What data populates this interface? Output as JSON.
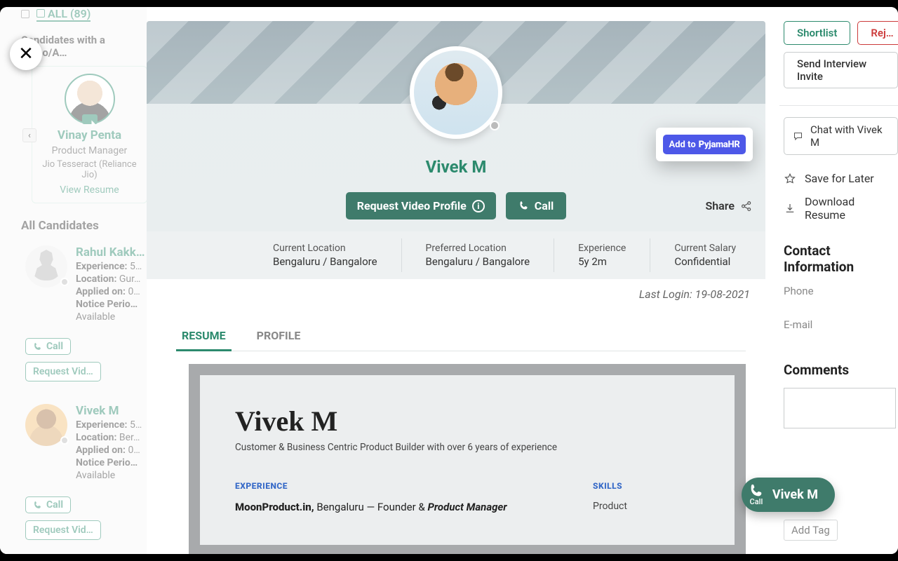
{
  "tabs": {
    "all_label": "ALL (89)",
    "checkbox_state": "unchecked"
  },
  "close_icon": "✕",
  "video_section_label": "Candidates with a Video/A…",
  "featured": {
    "name": "Vinay Penta",
    "role": "Product Manager",
    "company": "Jio Tesseract (Reliance Jio)",
    "view_label": "View Resume",
    "nav_prev": "‹"
  },
  "all_candidates_label": "All Candidates",
  "candidates": [
    {
      "name": "Rahul Kakk…",
      "experience_label": "Experience:",
      "experience_value": "5…",
      "location_label": "Location:",
      "location_value": "Gur…",
      "applied_label": "Applied on:",
      "applied_value": "0…",
      "notice_label": "Notice Perio…",
      "availability": "Available",
      "call_label": "Call",
      "request_label": "Request Vid…",
      "has_photo": false
    },
    {
      "name": "Vivek M",
      "experience_label": "Experience:",
      "experience_value": "5…",
      "location_label": "Location:",
      "location_value": "Ber…",
      "applied_label": "Applied on:",
      "applied_value": "0…",
      "notice_label": "Notice Perio…",
      "availability": "Available",
      "call_label": "Call",
      "request_label": "Request Vid…",
      "has_photo": true
    }
  ],
  "profile": {
    "name": "Vivek M",
    "request_video_label": "Request Video Profile",
    "call_label": "Call",
    "share_label": "Share",
    "highlight": {
      "add_to": "Add to",
      "brand": "PyjamaHR"
    },
    "meta": [
      {
        "label": "Current Location",
        "value": "Bengaluru / Bangalore"
      },
      {
        "label": "Preferred Location",
        "value": "Bengaluru / Bangalore"
      },
      {
        "label": "Experience",
        "value": "5y 2m"
      },
      {
        "label": "Current Salary",
        "value": "Confidential"
      }
    ],
    "last_login_label": "Last Login: 19-08-2021",
    "tabs": {
      "resume": "RESUME",
      "profile": "PROFILE",
      "active": "resume"
    },
    "resume": {
      "name": "Vivek M",
      "tagline": "Customer & Business Centric Product Builder with over 6 years of experience",
      "sections": {
        "experience": "EXPERIENCE",
        "skills": "SKILLS"
      },
      "experience_line": {
        "company": "MoonProduct.in,",
        "city": " Bengaluru — ",
        "role1": "Founder & ",
        "role2": "Product Manager"
      },
      "skill_item": "Product"
    }
  },
  "rail": {
    "shortlist": "Shortlist",
    "reject": "Rej…",
    "send_invite": "Send Interview Invite",
    "chat_label": "Chat with Vivek M",
    "save_later": "Save for Later",
    "download_resume": "Download Resume",
    "contact_header": "Contact Information",
    "phone_label": "Phone",
    "email_label": "E-mail",
    "comments_header": "Comments",
    "add_tag_placeholder": "Add Tag"
  },
  "call_pill": {
    "icon_label": "Call",
    "name": "Vivek M"
  }
}
